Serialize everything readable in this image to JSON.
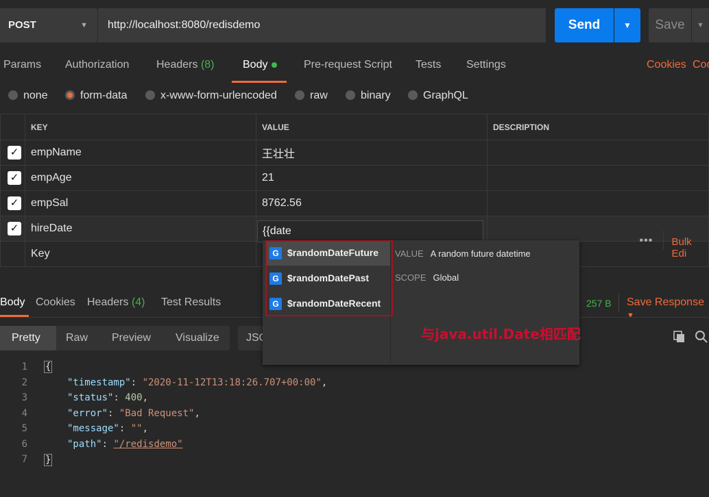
{
  "request": {
    "method": "POST",
    "url": "http://localhost:8080/redisdemo",
    "send_label": "Send",
    "save_label": "Save"
  },
  "request_tabs": {
    "params": "Params",
    "authorization": "Authorization",
    "headers": "Headers",
    "headers_count": "(8)",
    "body": "Body",
    "pre_request": "Pre-request Script",
    "tests": "Tests",
    "settings": "Settings",
    "cookies": "Cookies",
    "code": "Coo"
  },
  "body_types": {
    "none": "none",
    "form_data": "form-data",
    "urlencoded": "x-www-form-urlencoded",
    "raw": "raw",
    "binary": "binary",
    "graphql": "GraphQL",
    "selected": "form-data"
  },
  "params_table": {
    "headers": {
      "key": "KEY",
      "value": "VALUE",
      "description": "DESCRIPTION",
      "bulk_edit": "Bulk Edi"
    },
    "rows": [
      {
        "key": "empName",
        "value": "王壮壮",
        "checked": true
      },
      {
        "key": "empAge",
        "value": "21",
        "checked": true
      },
      {
        "key": "empSal",
        "value": "8762.56",
        "checked": true
      },
      {
        "key": "hireDate",
        "value": "{{date",
        "checked": true
      }
    ],
    "new_key_placeholder": "Key"
  },
  "autocomplete": {
    "items": [
      {
        "icon": "G",
        "label": "$randomDateFuture",
        "selected": true
      },
      {
        "icon": "G",
        "label": "$randomDatePast",
        "selected": false
      },
      {
        "icon": "G",
        "label": "$randomDateRecent",
        "selected": false
      }
    ],
    "detail": {
      "value_label": "VALUE",
      "value_text": "A random future datetime",
      "scope_label": "SCOPE",
      "scope_text": "Global"
    },
    "annotation": "与java.util.Date相匹配"
  },
  "response_tabs": {
    "body": "Body",
    "cookies": "Cookies",
    "headers": "Headers",
    "headers_count": "(4)",
    "test_results": "Test Results",
    "size": "257 B",
    "save_response": "Save Response"
  },
  "view_modes": {
    "pretty": "Pretty",
    "raw": "Raw",
    "preview": "Preview",
    "visualize": "Visualize",
    "format": "JSO"
  },
  "response_body": {
    "line_numbers": [
      "1",
      "2",
      "3",
      "4",
      "5",
      "6",
      "7"
    ],
    "timestamp_key": "\"timestamp\"",
    "timestamp_val": "\"2020-11-12T13:18:26.707+00:00\"",
    "status_key": "\"status\"",
    "status_val": "400",
    "error_key": "\"error\"",
    "error_val": "\"Bad Request\"",
    "message_key": "\"message\"",
    "message_val": "\"\"",
    "path_key": "\"path\"",
    "path_val": "\"/redisdemo\""
  },
  "colors": {
    "accent": "#f26b3a",
    "send": "#097bed",
    "background": "#282828",
    "annotation": "#c8102e"
  }
}
